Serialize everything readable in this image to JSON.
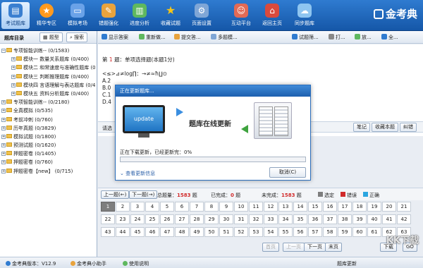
{
  "toolbar": {
    "items": [
      {
        "label": "考试题库",
        "icon": "book-icon",
        "color": "#e9f2fd",
        "active": true
      },
      {
        "label": "精华专区",
        "icon": "star-badge-icon",
        "color": "#ff9a1f"
      },
      {
        "label": "模拟考场",
        "icon": "monitor-icon",
        "color": "#6aa2e8"
      },
      {
        "label": "错题强化",
        "icon": "pencil-icon",
        "color": "#e8a33d"
      },
      {
        "label": "进度分析",
        "icon": "chart-icon",
        "color": "#5fb85f"
      },
      {
        "label": "收藏试题",
        "icon": "star-icon",
        "color": "#f5c518"
      },
      {
        "label": "页面设置",
        "icon": "gear-icon",
        "color": "#7fa6d6"
      },
      {
        "label": "互动平台",
        "icon": "people-icon",
        "color": "#e26a55"
      },
      {
        "label": "返回主页",
        "icon": "home-icon",
        "color": "#d94a3d"
      },
      {
        "label": "同步题库",
        "icon": "cloud-icon",
        "color": "#8ec5f0"
      }
    ],
    "brand": "金考典"
  },
  "sidebar": {
    "title": "题库目录",
    "btn_topic": "题型",
    "btn_search": "搜索",
    "tree": [
      {
        "label": "专项智能训练-- (0/1583)",
        "expand": "−",
        "child": false
      },
      {
        "label": "模块一  数量关系题库 (0/400)",
        "expand": "+",
        "child": true
      },
      {
        "label": "模块二  和常速度与准确性题库 (0/400)",
        "expand": "+",
        "child": true
      },
      {
        "label": "模块三  判断推理题库 (0/400)",
        "expand": "+",
        "child": true
      },
      {
        "label": "模块四  言语理解与表达题库 (0/400)",
        "expand": "+",
        "child": true
      },
      {
        "label": "模块五  资料分析题库 (0/400)",
        "expand": "+",
        "child": true
      },
      {
        "label": "专项智能训练-- (0/2180)",
        "expand": "+",
        "child": false
      },
      {
        "label": "全真模拟 (0/535)",
        "expand": "+",
        "child": false
      },
      {
        "label": "考前冲刺 (0/760)",
        "expand": "+",
        "child": false
      },
      {
        "label": "历年真题 (0/3829)",
        "expand": "+",
        "child": false
      },
      {
        "label": "模拟试题 (0/1800)",
        "expand": "+",
        "child": false
      },
      {
        "label": "预测试题 (0/1620)",
        "expand": "+",
        "child": false
      },
      {
        "label": "押题密卷 (0/1405)",
        "expand": "+",
        "child": false
      },
      {
        "label": "押题密卷 (0/760)",
        "expand": "+",
        "child": false
      },
      {
        "label": "押题密卷【new】 (0/715)",
        "expand": "+",
        "child": false
      }
    ]
  },
  "main_toolbar": {
    "show_answer": "显示答案",
    "redo": "重新做...",
    "submit": "提交答...",
    "multi_window": "多题模...",
    "filter": "试题筛...",
    "print": "打...",
    "zoom_in": "放...",
    "zoom_out": "全..."
  },
  "question": {
    "number_label": "第",
    "number": "1",
    "type_text": "题：单项选择题(本题1分)",
    "stem": "<≤>⊿≠log∏：→≠≈ħ∐⊙",
    "options": [
      "A.2",
      "B.0",
      "C.1",
      "D.4"
    ]
  },
  "answer_bar": {
    "label": "请选",
    "note_btn": "笔记",
    "fav_btn": "收藏本题",
    "correct_btn": "纠错"
  },
  "nav": {
    "prev": "上一题(←)",
    "next": "下一题(→)",
    "total_label": "总题量：",
    "total": "1583",
    "total_unit": "题",
    "done_label": "已完成：",
    "done": "0",
    "done_unit": "题",
    "undone_label": "未完成：",
    "undone": "1583",
    "undone_unit": "题",
    "legend": [
      {
        "label": "选定",
        "color": "#7e7e7e"
      },
      {
        "label": "错误",
        "color": "#d12a2a"
      },
      {
        "label": "正确",
        "color": "#2aa5e0"
      }
    ]
  },
  "grid": {
    "rows": [
      [
        "1",
        "2",
        "3",
        "4",
        "5",
        "6",
        "7",
        "8",
        "9",
        "10",
        "11",
        "12",
        "13",
        "14",
        "15",
        "16",
        "17",
        "18",
        "19",
        "20",
        "21"
      ],
      [
        "22",
        "23",
        "24",
        "25",
        "26",
        "27",
        "28",
        "29",
        "30",
        "31",
        "32",
        "33",
        "34",
        "35",
        "36",
        "37",
        "38",
        "39",
        "40",
        "41",
        "42"
      ],
      [
        "43",
        "44",
        "45",
        "46",
        "47",
        "48",
        "49",
        "50",
        "51",
        "52",
        "53",
        "54",
        "55",
        "56",
        "57",
        "58",
        "59",
        "60",
        "61",
        "62",
        "63"
      ]
    ]
  },
  "pager": {
    "first": "首页",
    "prev": "上一页",
    "next": "下一页",
    "last": "末页",
    "goto": "下载",
    "go": "GO"
  },
  "statusbar": {
    "version": "金考典版本：V12.9",
    "assistant": "金考典小助手",
    "manual": "使用说明",
    "right": "题库更新"
  },
  "modal": {
    "title": "正在更新题库...",
    "screen_text": "update",
    "headline": "题库在线更新",
    "progress_text": "正在下载更新，已经更新完：0%",
    "progress": 0,
    "details": "查看更新信息",
    "cancel": "取消(C)"
  },
  "watermark": "KK下载"
}
